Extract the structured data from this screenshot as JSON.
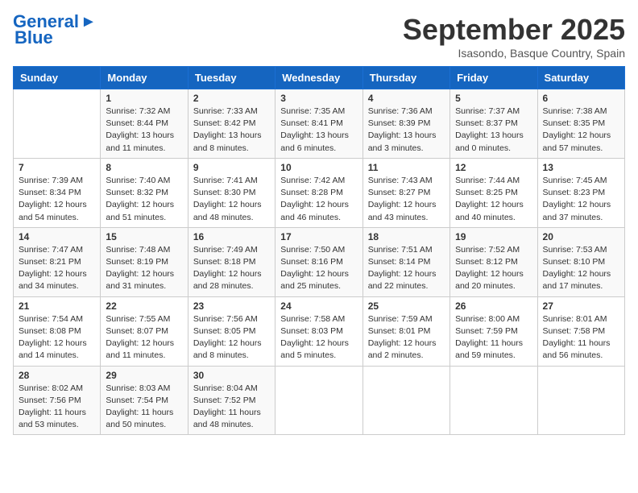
{
  "header": {
    "logo_line1": "General",
    "logo_line2": "Blue",
    "month": "September 2025",
    "location": "Isasondo, Basque Country, Spain"
  },
  "weekdays": [
    "Sunday",
    "Monday",
    "Tuesday",
    "Wednesday",
    "Thursday",
    "Friday",
    "Saturday"
  ],
  "weeks": [
    [
      {
        "day": "",
        "sunrise": "",
        "sunset": "",
        "daylight": ""
      },
      {
        "day": "1",
        "sunrise": "Sunrise: 7:32 AM",
        "sunset": "Sunset: 8:44 PM",
        "daylight": "Daylight: 13 hours and 11 minutes."
      },
      {
        "day": "2",
        "sunrise": "Sunrise: 7:33 AM",
        "sunset": "Sunset: 8:42 PM",
        "daylight": "Daylight: 13 hours and 8 minutes."
      },
      {
        "day": "3",
        "sunrise": "Sunrise: 7:35 AM",
        "sunset": "Sunset: 8:41 PM",
        "daylight": "Daylight: 13 hours and 6 minutes."
      },
      {
        "day": "4",
        "sunrise": "Sunrise: 7:36 AM",
        "sunset": "Sunset: 8:39 PM",
        "daylight": "Daylight: 13 hours and 3 minutes."
      },
      {
        "day": "5",
        "sunrise": "Sunrise: 7:37 AM",
        "sunset": "Sunset: 8:37 PM",
        "daylight": "Daylight: 13 hours and 0 minutes."
      },
      {
        "day": "6",
        "sunrise": "Sunrise: 7:38 AM",
        "sunset": "Sunset: 8:35 PM",
        "daylight": "Daylight: 12 hours and 57 minutes."
      }
    ],
    [
      {
        "day": "7",
        "sunrise": "Sunrise: 7:39 AM",
        "sunset": "Sunset: 8:34 PM",
        "daylight": "Daylight: 12 hours and 54 minutes."
      },
      {
        "day": "8",
        "sunrise": "Sunrise: 7:40 AM",
        "sunset": "Sunset: 8:32 PM",
        "daylight": "Daylight: 12 hours and 51 minutes."
      },
      {
        "day": "9",
        "sunrise": "Sunrise: 7:41 AM",
        "sunset": "Sunset: 8:30 PM",
        "daylight": "Daylight: 12 hours and 48 minutes."
      },
      {
        "day": "10",
        "sunrise": "Sunrise: 7:42 AM",
        "sunset": "Sunset: 8:28 PM",
        "daylight": "Daylight: 12 hours and 46 minutes."
      },
      {
        "day": "11",
        "sunrise": "Sunrise: 7:43 AM",
        "sunset": "Sunset: 8:27 PM",
        "daylight": "Daylight: 12 hours and 43 minutes."
      },
      {
        "day": "12",
        "sunrise": "Sunrise: 7:44 AM",
        "sunset": "Sunset: 8:25 PM",
        "daylight": "Daylight: 12 hours and 40 minutes."
      },
      {
        "day": "13",
        "sunrise": "Sunrise: 7:45 AM",
        "sunset": "Sunset: 8:23 PM",
        "daylight": "Daylight: 12 hours and 37 minutes."
      }
    ],
    [
      {
        "day": "14",
        "sunrise": "Sunrise: 7:47 AM",
        "sunset": "Sunset: 8:21 PM",
        "daylight": "Daylight: 12 hours and 34 minutes."
      },
      {
        "day": "15",
        "sunrise": "Sunrise: 7:48 AM",
        "sunset": "Sunset: 8:19 PM",
        "daylight": "Daylight: 12 hours and 31 minutes."
      },
      {
        "day": "16",
        "sunrise": "Sunrise: 7:49 AM",
        "sunset": "Sunset: 8:18 PM",
        "daylight": "Daylight: 12 hours and 28 minutes."
      },
      {
        "day": "17",
        "sunrise": "Sunrise: 7:50 AM",
        "sunset": "Sunset: 8:16 PM",
        "daylight": "Daylight: 12 hours and 25 minutes."
      },
      {
        "day": "18",
        "sunrise": "Sunrise: 7:51 AM",
        "sunset": "Sunset: 8:14 PM",
        "daylight": "Daylight: 12 hours and 22 minutes."
      },
      {
        "day": "19",
        "sunrise": "Sunrise: 7:52 AM",
        "sunset": "Sunset: 8:12 PM",
        "daylight": "Daylight: 12 hours and 20 minutes."
      },
      {
        "day": "20",
        "sunrise": "Sunrise: 7:53 AM",
        "sunset": "Sunset: 8:10 PM",
        "daylight": "Daylight: 12 hours and 17 minutes."
      }
    ],
    [
      {
        "day": "21",
        "sunrise": "Sunrise: 7:54 AM",
        "sunset": "Sunset: 8:08 PM",
        "daylight": "Daylight: 12 hours and 14 minutes."
      },
      {
        "day": "22",
        "sunrise": "Sunrise: 7:55 AM",
        "sunset": "Sunset: 8:07 PM",
        "daylight": "Daylight: 12 hours and 11 minutes."
      },
      {
        "day": "23",
        "sunrise": "Sunrise: 7:56 AM",
        "sunset": "Sunset: 8:05 PM",
        "daylight": "Daylight: 12 hours and 8 minutes."
      },
      {
        "day": "24",
        "sunrise": "Sunrise: 7:58 AM",
        "sunset": "Sunset: 8:03 PM",
        "daylight": "Daylight: 12 hours and 5 minutes."
      },
      {
        "day": "25",
        "sunrise": "Sunrise: 7:59 AM",
        "sunset": "Sunset: 8:01 PM",
        "daylight": "Daylight: 12 hours and 2 minutes."
      },
      {
        "day": "26",
        "sunrise": "Sunrise: 8:00 AM",
        "sunset": "Sunset: 7:59 PM",
        "daylight": "Daylight: 11 hours and 59 minutes."
      },
      {
        "day": "27",
        "sunrise": "Sunrise: 8:01 AM",
        "sunset": "Sunset: 7:58 PM",
        "daylight": "Daylight: 11 hours and 56 minutes."
      }
    ],
    [
      {
        "day": "28",
        "sunrise": "Sunrise: 8:02 AM",
        "sunset": "Sunset: 7:56 PM",
        "daylight": "Daylight: 11 hours and 53 minutes."
      },
      {
        "day": "29",
        "sunrise": "Sunrise: 8:03 AM",
        "sunset": "Sunset: 7:54 PM",
        "daylight": "Daylight: 11 hours and 50 minutes."
      },
      {
        "day": "30",
        "sunrise": "Sunrise: 8:04 AM",
        "sunset": "Sunset: 7:52 PM",
        "daylight": "Daylight: 11 hours and 48 minutes."
      },
      {
        "day": "",
        "sunrise": "",
        "sunset": "",
        "daylight": ""
      },
      {
        "day": "",
        "sunrise": "",
        "sunset": "",
        "daylight": ""
      },
      {
        "day": "",
        "sunrise": "",
        "sunset": "",
        "daylight": ""
      },
      {
        "day": "",
        "sunrise": "",
        "sunset": "",
        "daylight": ""
      }
    ]
  ]
}
